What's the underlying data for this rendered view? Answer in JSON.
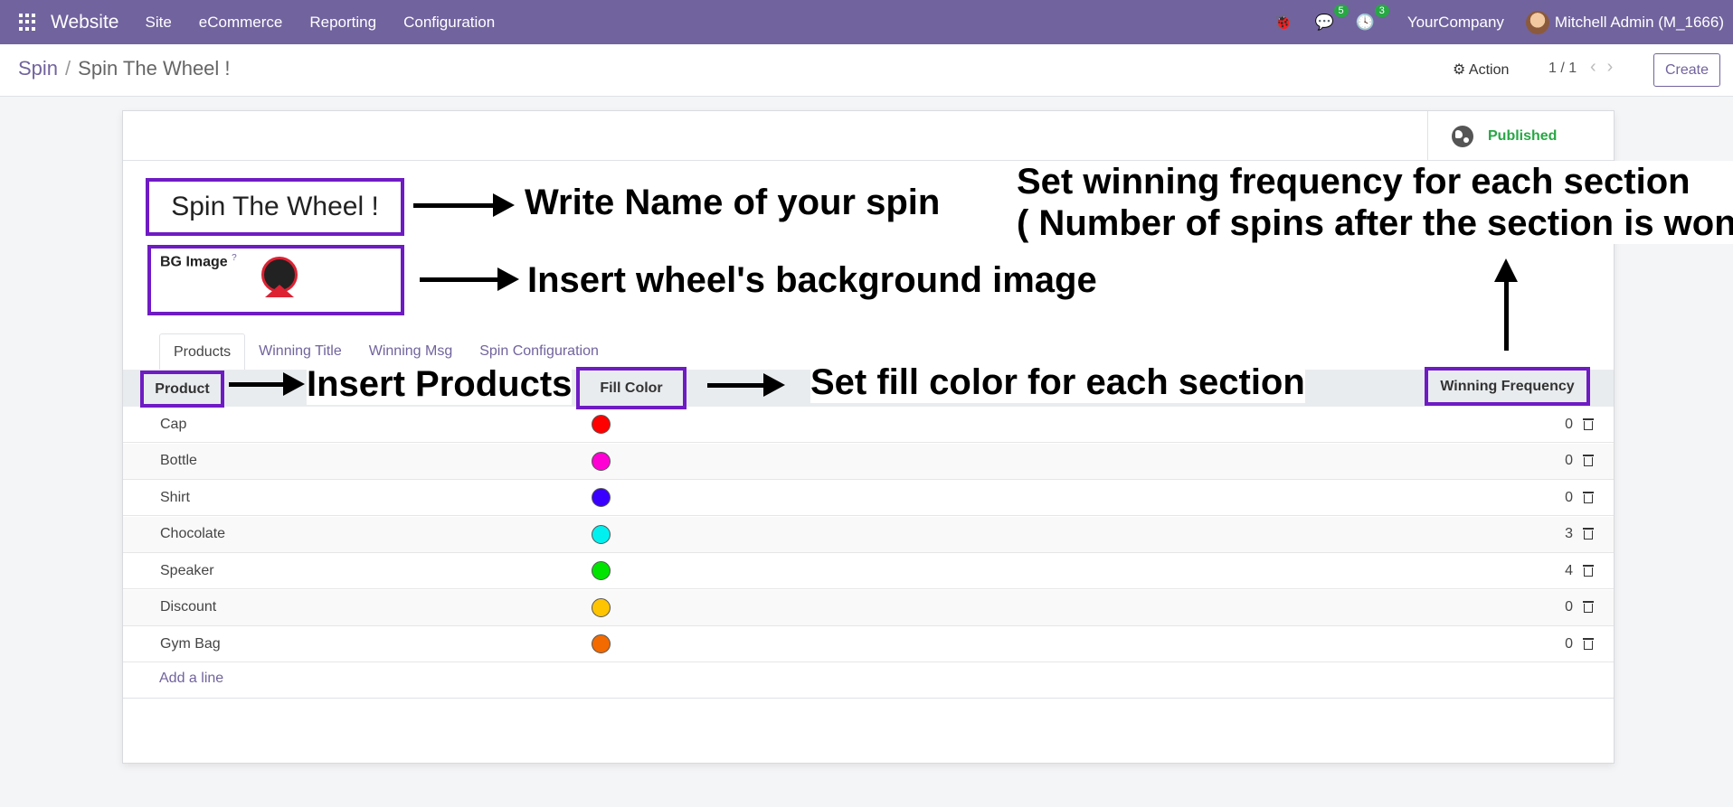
{
  "navbar": {
    "brand": "Website",
    "menu": [
      "Site",
      "eCommerce",
      "Reporting",
      "Configuration"
    ],
    "messages_count": "5",
    "activities_count": "3",
    "company": "YourCompany",
    "user": "Mitchell Admin (M_1666)"
  },
  "control": {
    "breadcrumb_parent": "Spin",
    "breadcrumb_sep": "/",
    "breadcrumb_current": "Spin The Wheel !",
    "action_label": "⚙ Action",
    "pager": "1 / 1",
    "pager_prev": "‹",
    "pager_next": "›",
    "create_label": "Create"
  },
  "record": {
    "published_label": "Published",
    "name": "Spin The Wheel !",
    "bg_image_label": "BG Image",
    "bg_image_help": "?"
  },
  "tabs": [
    "Products",
    "Winning Title",
    "Winning Msg",
    "Spin Configuration"
  ],
  "table": {
    "headers": {
      "product": "Product",
      "fill_color": "Fill Color",
      "winning_frequency": "Winning Frequency"
    },
    "rows": [
      {
        "product": "Cap",
        "color": "#ff0000",
        "frequency": "0"
      },
      {
        "product": "Bottle",
        "color": "#ff00d4",
        "frequency": "0"
      },
      {
        "product": "Shirt",
        "color": "#3a00ff",
        "frequency": "0"
      },
      {
        "product": "Chocolate",
        "color": "#00f0f0",
        "frequency": "3"
      },
      {
        "product": "Speaker",
        "color": "#00e400",
        "frequency": "4"
      },
      {
        "product": "Discount",
        "color": "#ffc400",
        "frequency": "0"
      },
      {
        "product": "Gym Bag",
        "color": "#f26a00",
        "frequency": "0"
      }
    ],
    "add_line": "Add a line"
  },
  "annotations": {
    "name": "Write Name of your spin",
    "bg_image": "Insert wheel's background image",
    "products": "Insert Products",
    "fill_color": "Set fill color for each section",
    "frequency_line1": "Set winning frequency for each section",
    "frequency_line2": "( Number of spins after the section is won )"
  },
  "colors": {
    "navbar": "#71639e",
    "accent": "#71639e",
    "highlight": "#6f1bc4",
    "published": "#28a745"
  }
}
